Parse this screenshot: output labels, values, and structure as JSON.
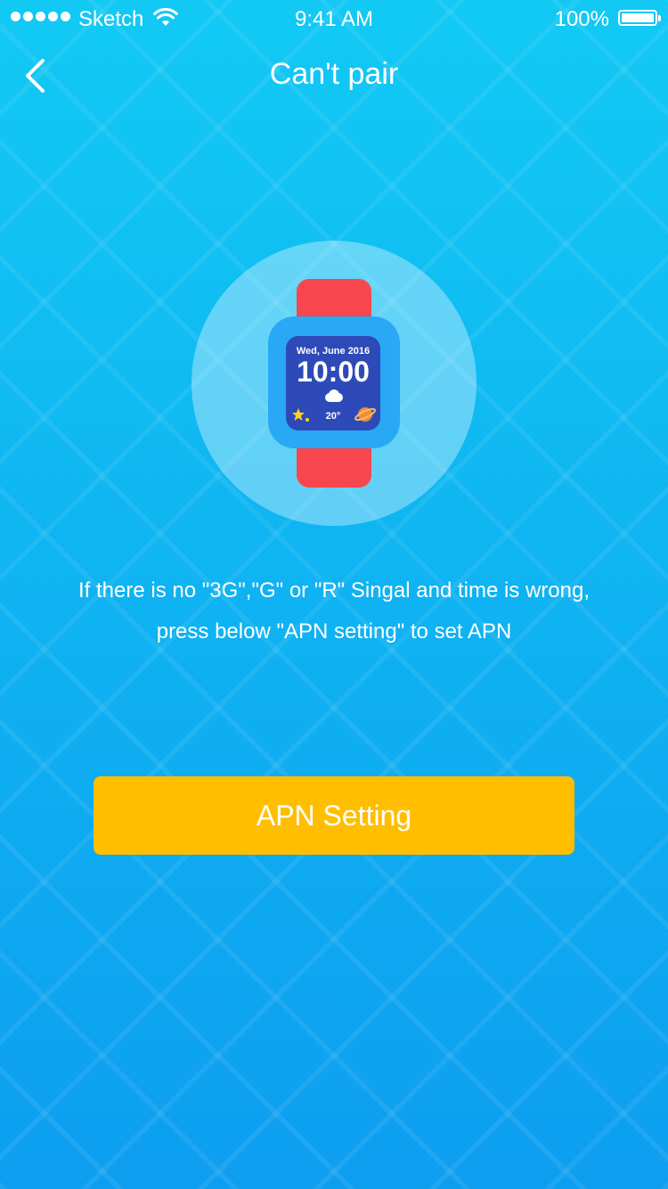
{
  "status_bar": {
    "carrier": "Sketch",
    "time": "9:41 AM",
    "battery_percent": "100%",
    "signal_icon": "signal-dots-icon",
    "wifi_icon": "wifi-icon",
    "battery_icon": "battery-icon"
  },
  "nav": {
    "title": "Can't pair",
    "back_icon": "chevron-left-icon"
  },
  "watch": {
    "date": "Wed, June 2016",
    "time": "10:00",
    "temperature": "20°",
    "weather_icon": "cloud-icon"
  },
  "message": {
    "line1": "If there is no \"3G\",\"G\" or \"R\" Singal and time is wrong,",
    "line2": "press below \"APN setting\" to set APN"
  },
  "apn_button": {
    "label": "APN Setting"
  },
  "colors": {
    "background_top": "#12c9f4",
    "background_bottom": "#0e9ef0",
    "button": "#ffbe00",
    "strap": "#f7464d",
    "watch_body": "#29a8f6",
    "watch_screen": "#2d4ab8"
  }
}
